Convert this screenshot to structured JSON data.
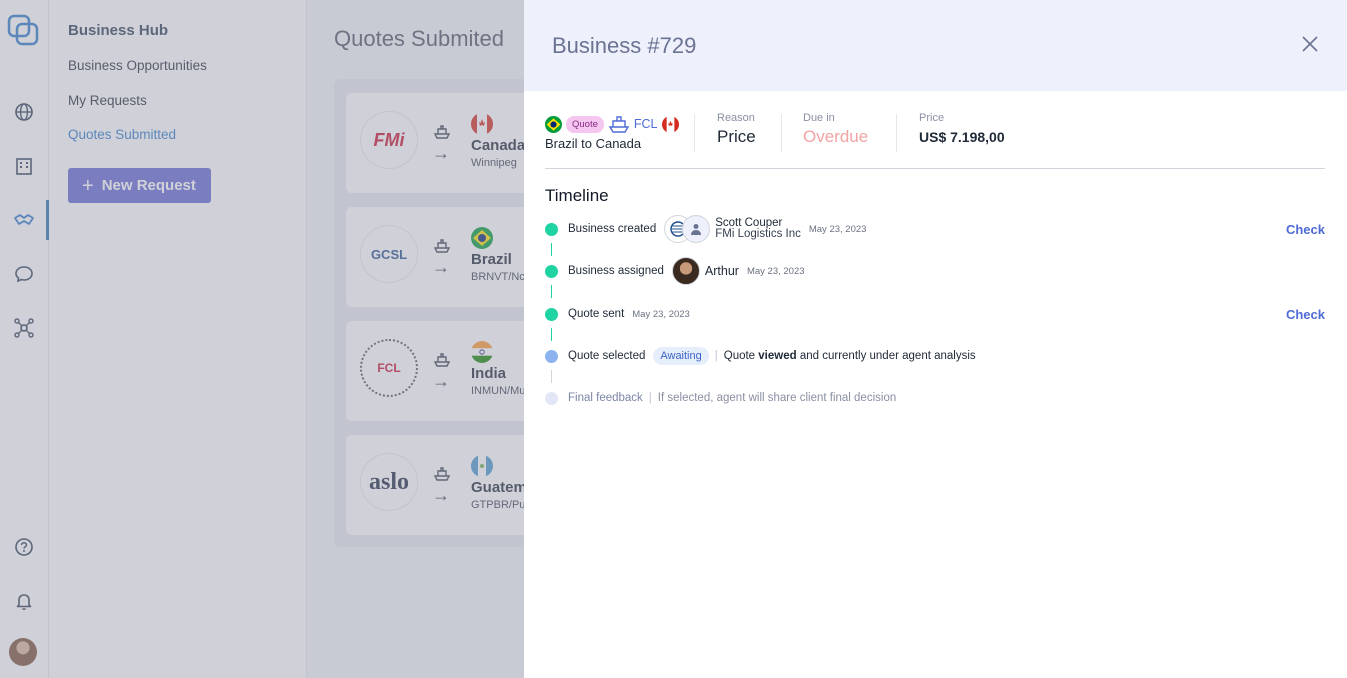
{
  "sidebar": {
    "title": "Business Hub",
    "items": [
      {
        "label": "Business Opportunities"
      },
      {
        "label": "My Requests"
      },
      {
        "label": "Quotes Submitted"
      }
    ],
    "new_request_label": "New Request"
  },
  "main": {
    "title": "Quotes Submited",
    "cards": [
      {
        "logo": "FMi",
        "country": "Canada",
        "code": "Winnipeg"
      },
      {
        "logo": "GCSL",
        "country": "Brazil",
        "code": "BRNVT/Nc"
      },
      {
        "logo": "FCL",
        "country": "India",
        "code": "INMUN/Mu"
      },
      {
        "logo": "aslo",
        "country": "Guatem",
        "code": "GTPBR/Pu"
      }
    ]
  },
  "drawer": {
    "title": "Business #729",
    "summary": {
      "quote_badge": "Quote",
      "mode": "FCL",
      "route": "Brazil to Canada",
      "reason_label": "Reason",
      "reason_value": "Price",
      "due_label": "Due in",
      "due_value": "Overdue",
      "price_label": "Price",
      "price_value": "US$ 7.198,00"
    },
    "timeline": {
      "title": "Timeline",
      "steps": [
        {
          "label": "Business created",
          "person": "Scott Couper",
          "company": "FMi Logistics Inc",
          "date": "May 23, 2023",
          "action": "Check"
        },
        {
          "label": "Business assigned",
          "person": "Arthur",
          "date": "May 23, 2023"
        },
        {
          "label": "Quote sent",
          "date": "May 23, 2023",
          "action": "Check"
        },
        {
          "label": "Quote selected",
          "status": "Awaiting",
          "note_pre": "Quote",
          "note_bold": "viewed",
          "note_post": "and currently under agent analysis"
        },
        {
          "label": "Final feedback",
          "note": "If selected, agent will share client final decision"
        }
      ]
    }
  },
  "colors": {
    "accent": "#6366d1",
    "timeline_done": "#1fd3a3",
    "timeline_current": "#8db3ef",
    "overdue": "#f2a3a3",
    "link": "#4f6bd6"
  }
}
